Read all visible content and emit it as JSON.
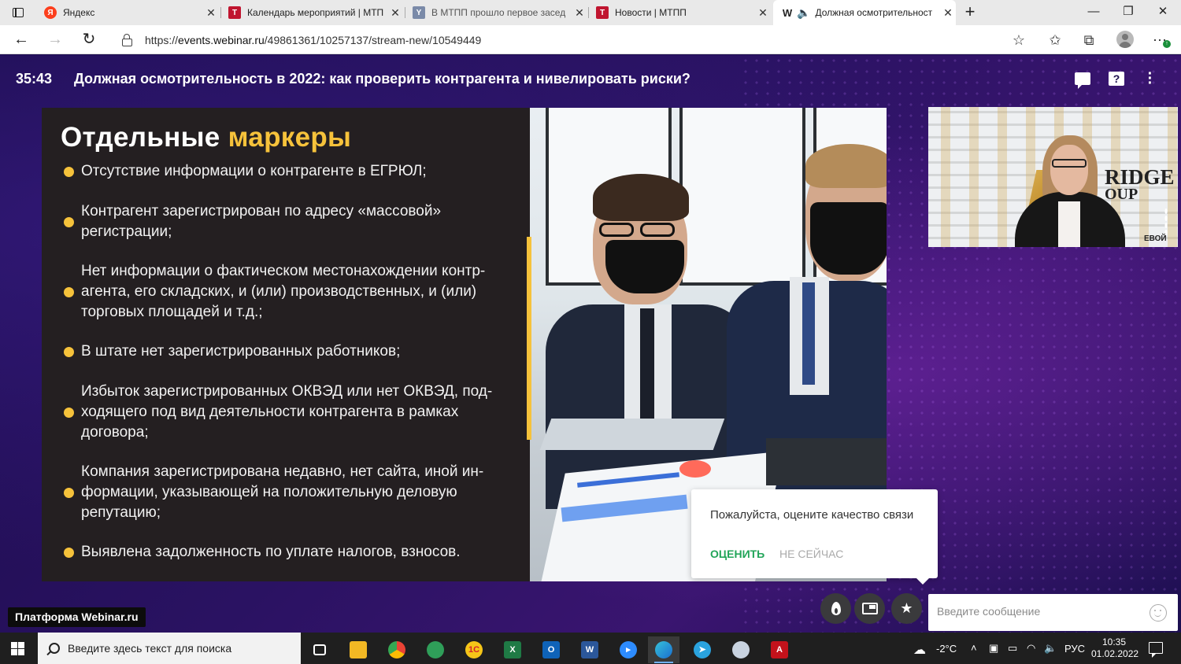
{
  "browser": {
    "tabs": [
      {
        "title": "Яндекс",
        "favicon": "Я",
        "favicon_color": "#fc3f1d"
      },
      {
        "title": "Календарь мероприятий | МТП",
        "favicon": "T",
        "favicon_color": "#c0152f"
      },
      {
        "title": "В МТПП прошло первое засед",
        "favicon": "Y",
        "favicon_color": "#7a8aa8"
      },
      {
        "title": "Новости | МТПП",
        "favicon": "T",
        "favicon_color": "#c0152f"
      },
      {
        "title": "Должная осмотрительност",
        "favicon": "W",
        "favicon_color": "#222222",
        "active": true
      }
    ],
    "close_glyph": "✕",
    "new_tab_glyph": "+",
    "url_prefix": "https://",
    "url_host": "events.webinar.ru",
    "url_path": "/49861361/10257137/stream-new/10549449"
  },
  "stream": {
    "timer": "35:43",
    "title": "Должная осмотрительность в 2022: как проверить контрагента и нивелировать риски?"
  },
  "slide": {
    "heading_plain": "Отдельные",
    "heading_accent": "маркеры",
    "accent_color": "#f6c23b",
    "bullets": [
      "Отсутствие информации о контрагенте в ЕГРЮЛ;",
      "Контрагент зарегистрирован по адресу «массовой» регистрации;",
      "Нет информации о фактическом местонахождении контр-агента, его складских, и (или) производственных, и (или) торговых площадей и т.д.;",
      "В штате нет зарегистрированных работников;",
      "Избыток зарегистрированных ОКВЭД или нет ОКВЭД, под-ходящего под вид деятельности контрагента в рамках договора;",
      "Компания зарегистрирована недавно, нет сайта, иной ин-формации, указывающей на положительную деловую репутацию;",
      "Выявлена задолженность по уплате налогов, взносов."
    ]
  },
  "webcam": {
    "logo_line1": "RIDGE",
    "logo_line2": "OUP",
    "logo_line3": "ЕВОЙ"
  },
  "rating_popup": {
    "text": "Пожалуйста, оцените качество связи",
    "rate_label": "ОЦЕНИТЬ",
    "later_label": "НЕ СЕЙЧАС",
    "rate_color": "#22a559"
  },
  "controls": {
    "platform_badge": "Платформа Webinar.ru",
    "message_placeholder": "Введите сообщение"
  },
  "taskbar": {
    "search_placeholder": "Введите здесь текст для поиска",
    "temperature": "-2°C",
    "language": "РУС",
    "time": "10:35",
    "date": "01.02.2022"
  }
}
